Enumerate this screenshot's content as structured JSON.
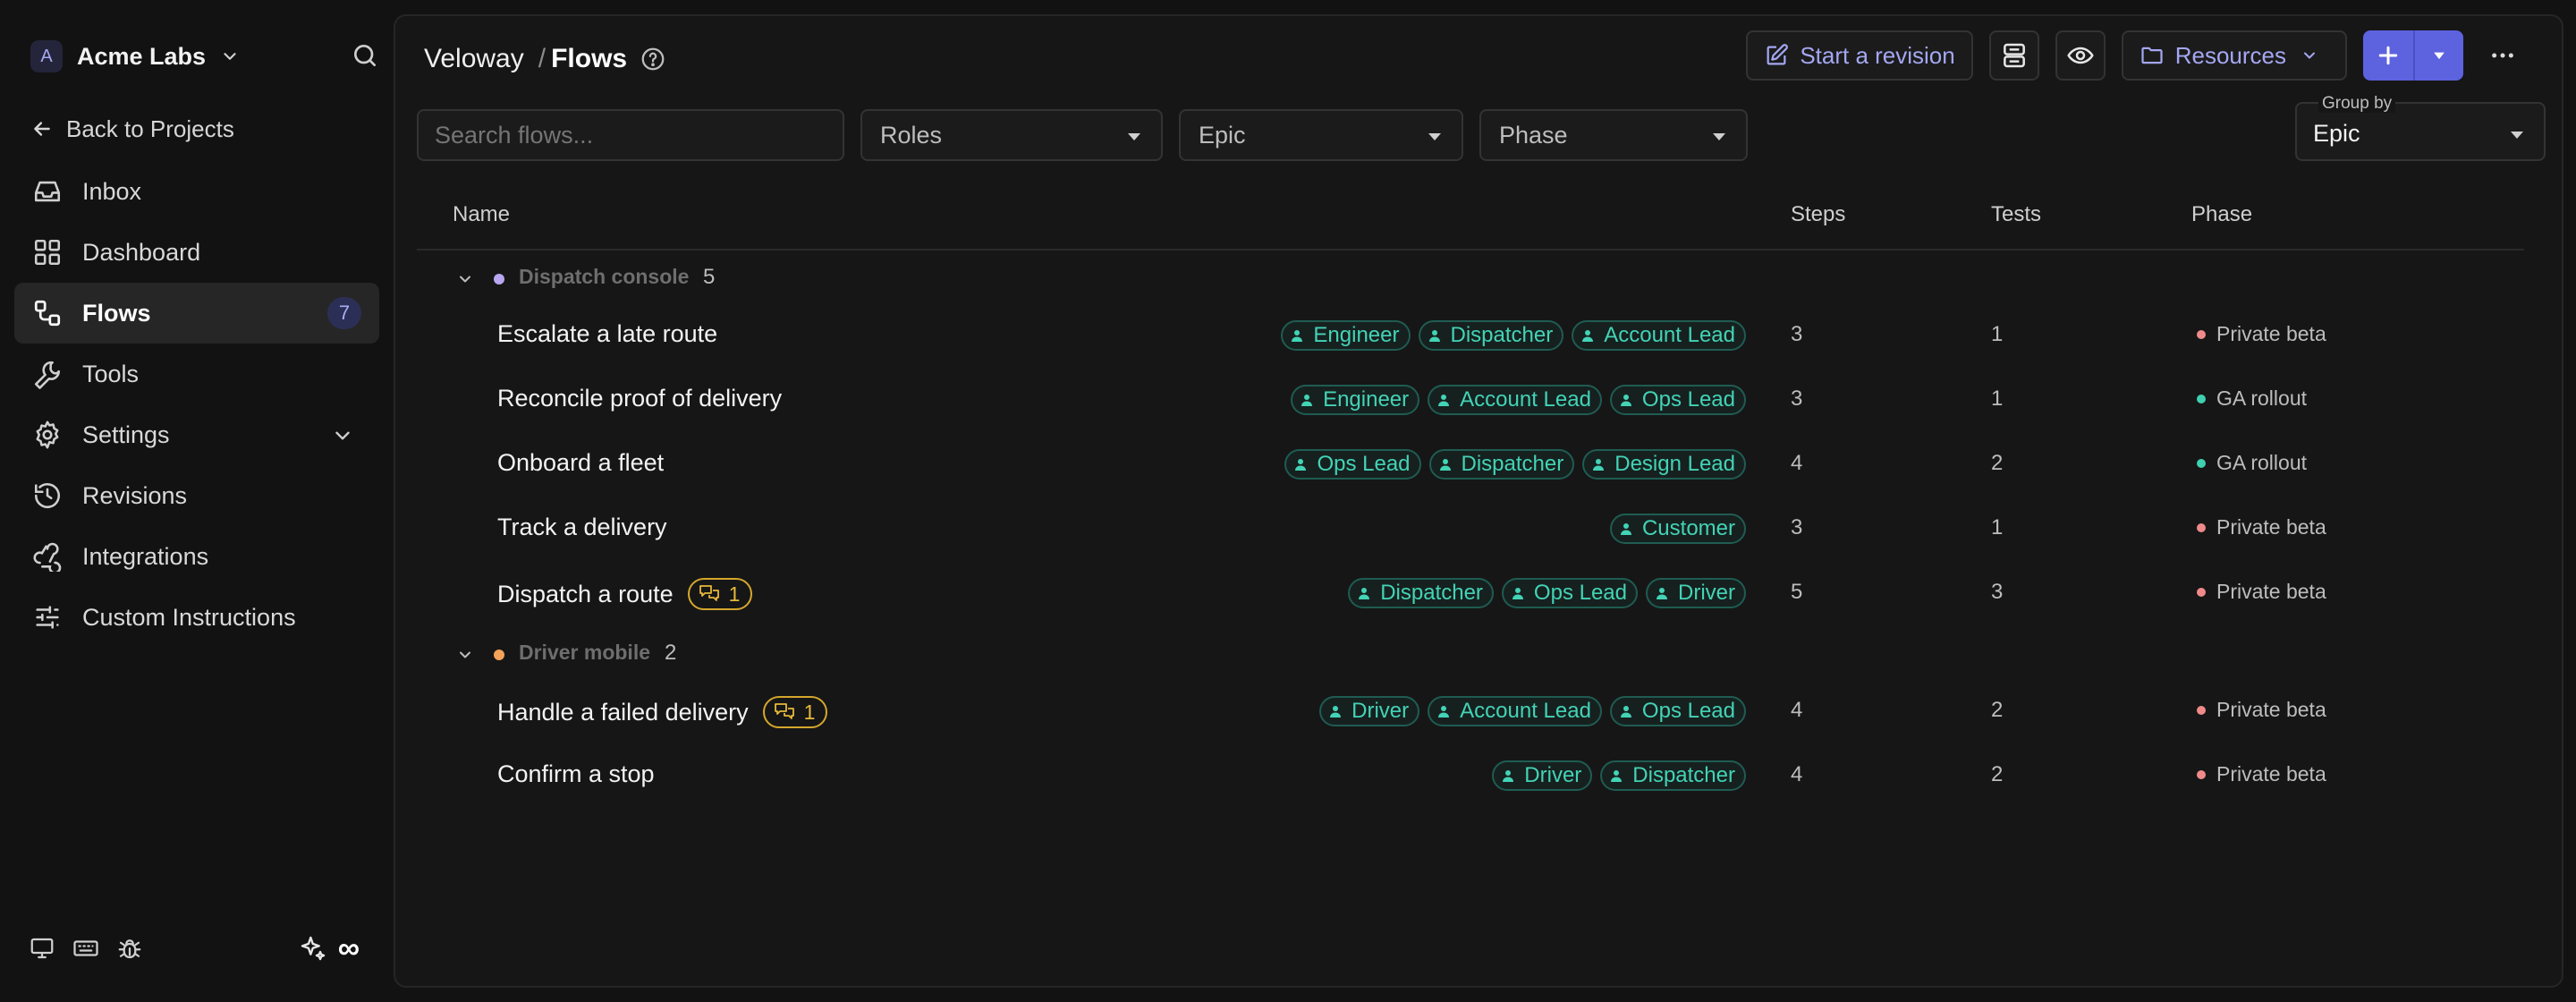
{
  "sidebar": {
    "org": {
      "initial": "A",
      "name": "Acme Labs"
    },
    "back_label": "Back to Projects",
    "items": [
      {
        "label": "Inbox",
        "icon": "inbox-icon"
      },
      {
        "label": "Dashboard",
        "icon": "dashboard-icon"
      },
      {
        "label": "Flows",
        "icon": "flows-icon",
        "badge": "7",
        "active": true
      },
      {
        "label": "Tools",
        "icon": "wrench-icon"
      },
      {
        "label": "Settings",
        "icon": "gear-icon",
        "expandable": true
      },
      {
        "label": "Revisions",
        "icon": "history-icon"
      },
      {
        "label": "Integrations",
        "icon": "webhook-icon"
      },
      {
        "label": "Custom Instructions",
        "icon": "sliders-icon"
      }
    ],
    "footer": {
      "infinity": "∞"
    }
  },
  "header": {
    "breadcrumb": {
      "project": "Veloway",
      "separator": "/",
      "page": "Flows"
    },
    "start_revision_label": "Start a revision",
    "resources_label": "Resources"
  },
  "filters": {
    "search_placeholder": "Search flows...",
    "roles_label": "Roles",
    "epic_label": "Epic",
    "phase_label": "Phase",
    "group_by_label": "Group by",
    "group_by_value": "Epic"
  },
  "table": {
    "columns": {
      "name": "Name",
      "steps": "Steps",
      "tests": "Tests",
      "phase": "Phase"
    },
    "groups": [
      {
        "name": "Dispatch console",
        "count": "5",
        "dot_color": "#b9a6f0",
        "flows": [
          {
            "name": "Escalate a late route",
            "roles": [
              "Engineer",
              "Dispatcher",
              "Account Lead"
            ],
            "steps": "3",
            "tests": "1",
            "phase": "Private beta",
            "phase_color": "#f08a8a"
          },
          {
            "name": "Reconcile proof of delivery",
            "roles": [
              "Engineer",
              "Account Lead",
              "Ops Lead"
            ],
            "steps": "3",
            "tests": "1",
            "phase": "GA rollout",
            "phase_color": "#3fd0b0"
          },
          {
            "name": "Onboard a fleet",
            "roles": [
              "Ops Lead",
              "Dispatcher",
              "Design Lead"
            ],
            "steps": "4",
            "tests": "2",
            "phase": "GA rollout",
            "phase_color": "#3fd0b0"
          },
          {
            "name": "Track a delivery",
            "roles": [
              "Customer"
            ],
            "steps": "3",
            "tests": "1",
            "phase": "Private beta",
            "phase_color": "#f08a8a"
          },
          {
            "name": "Dispatch a route",
            "comments": "1",
            "roles": [
              "Dispatcher",
              "Ops Lead",
              "Driver"
            ],
            "steps": "5",
            "tests": "3",
            "phase": "Private beta",
            "phase_color": "#f08a8a"
          }
        ]
      },
      {
        "name": "Driver mobile",
        "count": "2",
        "dot_color": "#f5a25a",
        "flows": [
          {
            "name": "Handle a failed delivery",
            "comments": "1",
            "roles": [
              "Driver",
              "Account Lead",
              "Ops Lead"
            ],
            "steps": "4",
            "tests": "2",
            "phase": "Private beta",
            "phase_color": "#f08a8a"
          },
          {
            "name": "Confirm a stop",
            "roles": [
              "Driver",
              "Dispatcher"
            ],
            "steps": "4",
            "tests": "2",
            "phase": "Private beta",
            "phase_color": "#f08a8a"
          }
        ]
      }
    ]
  }
}
